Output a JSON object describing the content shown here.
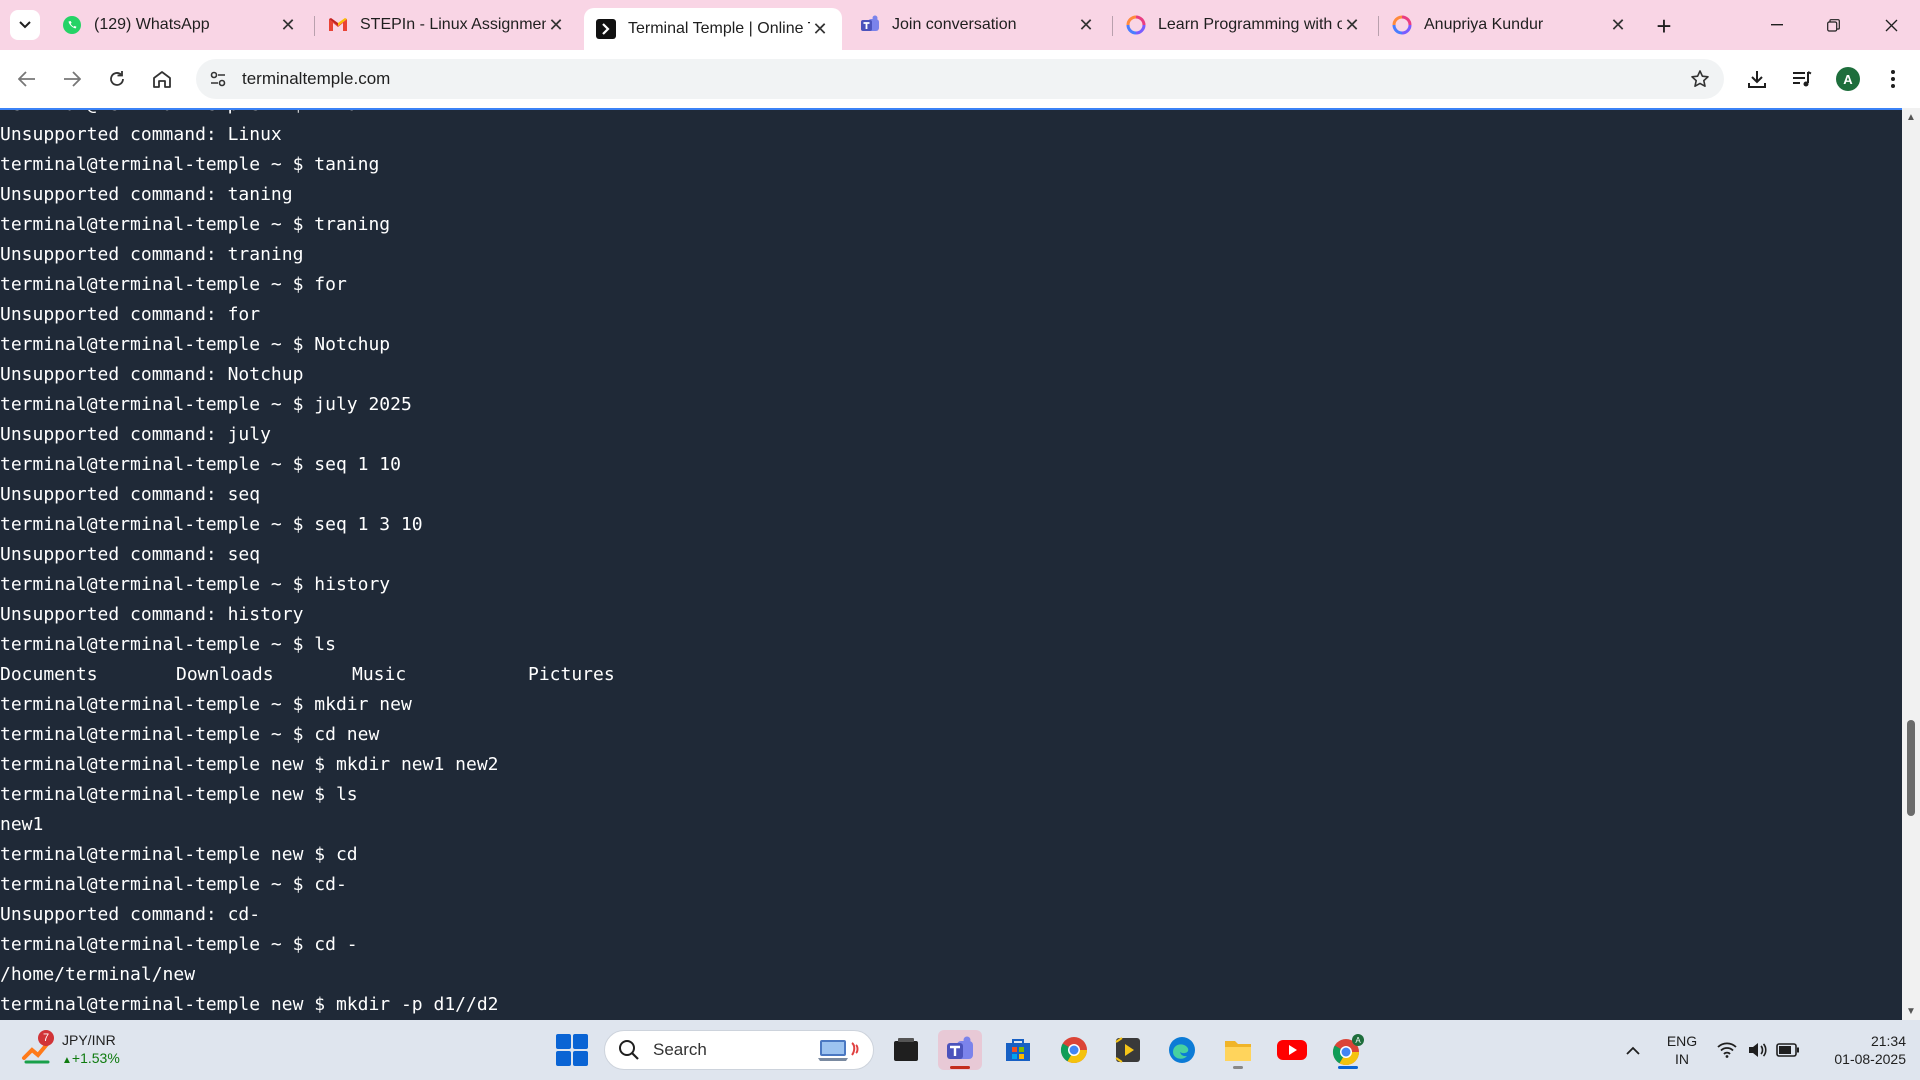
{
  "browser": {
    "tabs": [
      {
        "label": "(129) WhatsApp",
        "icon": "whatsapp-icon",
        "active": false
      },
      {
        "label": "STEPIn - Linux Assignment",
        "icon": "gmail-icon",
        "active": false
      },
      {
        "label": "Terminal Temple | Online Te",
        "icon": "terminal-icon",
        "active": true
      },
      {
        "label": "Join conversation",
        "icon": "teams-icon",
        "active": false
      },
      {
        "label": "Learn Programming with o",
        "icon": "swirl-icon",
        "active": false
      },
      {
        "label": "Anupriya Kundur",
        "icon": "swirl-icon",
        "active": false
      }
    ],
    "new_tab_label": "+",
    "url": "terminaltemple.com",
    "profile_initial": "A",
    "accent_color": "#f9d5e5"
  },
  "terminal": {
    "lines": [
      "terminal@terminal-temple ~ $ Linux",
      "Unsupported command: Linux",
      "terminal@terminal-temple ~ $ taning",
      "Unsupported command: taning",
      "terminal@terminal-temple ~ $ traning",
      "Unsupported command: traning",
      "terminal@terminal-temple ~ $ for",
      "Unsupported command: for",
      "terminal@terminal-temple ~ $ Notchup",
      "Unsupported command: Notchup",
      "terminal@terminal-temple ~ $ july 2025",
      "Unsupported command: july",
      "terminal@terminal-temple ~ $ seq 1 10",
      "Unsupported command: seq",
      "terminal@terminal-temple ~ $ seq 1 3 10",
      "Unsupported command: seq",
      "terminal@terminal-temple ~ $ history",
      "Unsupported command: history",
      "terminal@terminal-temple ~ $ ls"
    ],
    "ls_output": [
      "Documents",
      "Downloads",
      "Music",
      "Pictures"
    ],
    "lines_after": [
      "terminal@terminal-temple ~ $ mkdir new",
      "terminal@terminal-temple ~ $ cd new",
      "terminal@terminal-temple new $ mkdir new1 new2",
      "terminal@terminal-temple new $ ls",
      "new1",
      "terminal@terminal-temple new $ cd",
      "terminal@terminal-temple ~ $ cd-",
      "Unsupported command: cd-",
      "terminal@terminal-temple ~ $ cd -",
      "/home/terminal/new",
      "terminal@terminal-temple new $ mkdir -p d1//d2"
    ],
    "bg_color": "#1f2937",
    "text_color": "#ffffff"
  },
  "taskbar": {
    "widget": {
      "badge": "7",
      "title": "JPY/INR",
      "change": "+1.53%"
    },
    "search_label": "Search",
    "apps": [
      "file-manager-icon",
      "teams-icon",
      "store-icon",
      "chrome-icon",
      "media-player-icon",
      "edge-icon",
      "folder-icon",
      "youtube-icon",
      "chrome-profile-icon"
    ],
    "lang_line1": "ENG",
    "lang_line2": "IN",
    "time": "21:34",
    "date": "01-08-2025"
  }
}
